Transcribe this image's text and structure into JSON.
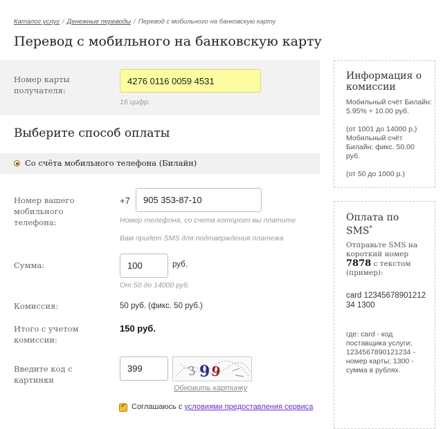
{
  "breadcrumb": {
    "items": [
      "Каталог услуг",
      "Денежные переводы"
    ],
    "current": "Перевод с мобильного на банковскую карту",
    "separator": "/"
  },
  "page_title": "Перевод с мобильного на банковскую карту",
  "card": {
    "label": "Номер карты получателя:",
    "value": "4276 0116 0059 4531",
    "hint": "16 цифр."
  },
  "payment_method": {
    "title": "Выберите способ оплаты",
    "option": "Со счёта мобильного телефона (Билайн)"
  },
  "phone": {
    "label": "Номер вашего мобильного телефона:",
    "prefix": "+7",
    "value": "905 353-87-10",
    "hint": "Номер телефона, со счета которого вы платите",
    "hint2": "Вам придет SMS для подтверждения платежа"
  },
  "amount": {
    "label": "Сумма:",
    "value": "100",
    "unit": "руб.",
    "hint": "От 50 до 14000 руб."
  },
  "commission": {
    "label": "Комиссия:",
    "value": "50 руб. (фикс. 50 руб.)"
  },
  "total": {
    "label": "Итого с учетом комиссии:",
    "value": "150 руб."
  },
  "captcha": {
    "label": "Введите код с картинки",
    "value": "399",
    "refresh": "Обновить картинку"
  },
  "agreement": {
    "text": "Соглашаюсь с",
    "link": "условиями предоставления сервиса"
  },
  "info_panel": {
    "title": "Информация о комиссии",
    "lines": [
      "Мобильный счёт Билайн:  5.95% + 10.00 руб.",
      "(от 1001 до 14000 р.)",
      "Мобильный счёт Билайн:  фикс. 50.00 руб.",
      "(от 50 до 1000 р.)"
    ]
  },
  "sms_panel": {
    "title": "Оплата по SMS",
    "title_mark": "*",
    "intro": "Отправьте SMS на короткий номер",
    "number": "7878",
    "intro_after": "с текстом (пример):",
    "example": "card 1234567890121234 1300",
    "explanation": "где: card - код поставщика услуги; 1234567890121234 - номер карты; 1300 - сумма в рублях."
  },
  "colors": {
    "card_input_bg": "#fcfca0",
    "band_bg": "#f2f2f2",
    "checkbox": "#f0c030",
    "link": "#6633cc"
  }
}
